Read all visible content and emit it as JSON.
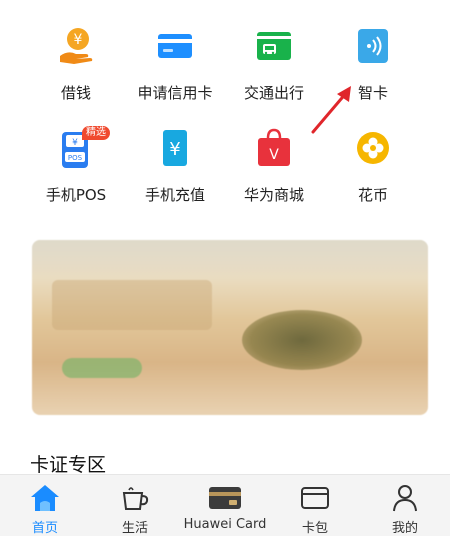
{
  "services": [
    {
      "label": "借钱",
      "icon": "loan-hand-icon",
      "color": "#f5a623"
    },
    {
      "label": "申请信用卡",
      "icon": "credit-card-icon",
      "color": "#1e8fff"
    },
    {
      "label": "交通出行",
      "icon": "bus-card-icon",
      "color": "#19b24b"
    },
    {
      "label": "智卡",
      "icon": "smart-card-icon",
      "color": "#3aa8e8"
    },
    {
      "label": "手机POS",
      "icon": "pos-icon",
      "color": "#2a7df0",
      "badge": "精选"
    },
    {
      "label": "手机充值",
      "icon": "recharge-icon",
      "color": "#18a8e0",
      "symbol": "¥"
    },
    {
      "label": "华为商城",
      "icon": "shopping-bag-icon",
      "color": "#e8323c",
      "symbol": "V"
    },
    {
      "label": "花币",
      "icon": "flower-coin-icon",
      "color": "#f6b600"
    }
  ],
  "section": {
    "title": "卡证专区"
  },
  "tabs": [
    {
      "label": "首页",
      "icon": "home-icon",
      "active": true
    },
    {
      "label": "生活",
      "icon": "coffee-cup-icon",
      "active": false
    },
    {
      "label": "Huawei Card",
      "icon": "card-icon",
      "active": false
    },
    {
      "label": "卡包",
      "icon": "wallet-card-icon",
      "active": false
    },
    {
      "label": "我的",
      "icon": "person-icon",
      "active": false
    }
  ],
  "colors": {
    "accent": "#1a8cff",
    "annotation_arrow": "#e0262b"
  }
}
